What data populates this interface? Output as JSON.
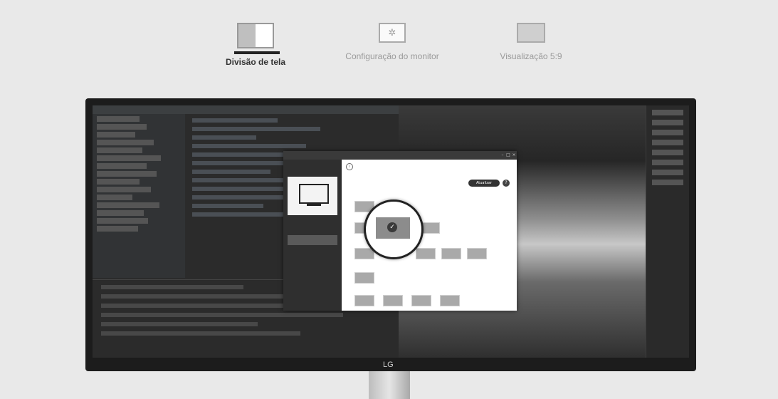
{
  "tabs": [
    {
      "label": "Divisão de tela",
      "icon": "split-screen-icon",
      "active": true
    },
    {
      "label": "Configuração do monitor",
      "icon": "monitor-settings-icon",
      "active": false
    },
    {
      "label": "Visualização 5:9",
      "icon": "preview-icon",
      "active": false
    }
  ],
  "monitor": {
    "brand": "LG"
  },
  "dialog": {
    "update_button": "Atualizar",
    "help": "?"
  },
  "colors": {
    "active_tab_text": "#333333",
    "inactive_tab_text": "#9a9a9a",
    "monitor_bezel": "#1c1c1c",
    "dialog_sidebar": "#2f2f2f"
  }
}
